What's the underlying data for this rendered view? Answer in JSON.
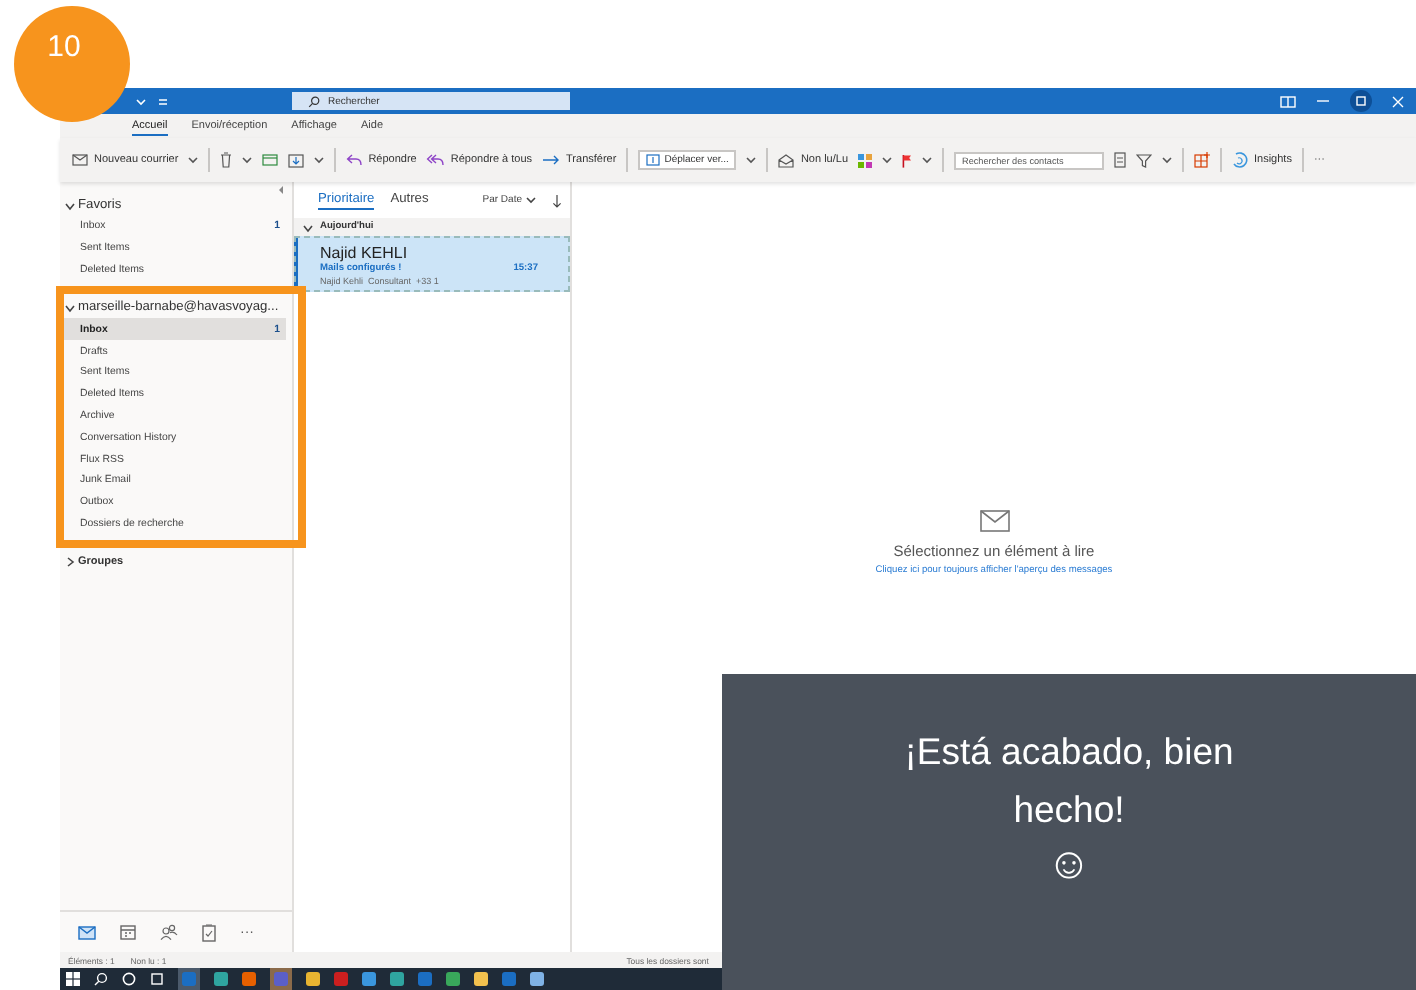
{
  "badge": "10",
  "title_bar": {
    "search_placeholder": "Rechercher"
  },
  "ribbon_tabs": [
    {
      "label": "Accueil",
      "selected": true
    },
    {
      "label": "Envoi/réception",
      "selected": false
    },
    {
      "label": "Affichage",
      "selected": false
    },
    {
      "label": "Aide",
      "selected": false
    }
  ],
  "toolbar": {
    "new_mail": "Nouveau courrier",
    "reply": "Répondre",
    "reply_all": "Répondre à tous",
    "forward": "Transférer",
    "move": "Déplacer ver...",
    "read_unread": "Non lu/Lu",
    "contact_search": {
      "placeholder": "Rechercher des contacts"
    },
    "insights": "Insights",
    "more": "···"
  },
  "folder_pane": {
    "sections": [
      {
        "label": "Favoris",
        "expanded": true,
        "items": [
          {
            "label": "Inbox",
            "count": "1",
            "selected": false
          },
          {
            "label": "Sent Items",
            "selected": false
          },
          {
            "label": "Deleted Items",
            "selected": false
          }
        ]
      },
      {
        "label": "marseille-barnabe@havasvoyag...",
        "expanded": true,
        "items": [
          {
            "label": "Inbox",
            "count": "1",
            "selected": true
          },
          {
            "label": "Drafts",
            "selected": false
          },
          {
            "label": "Sent Items",
            "selected": false
          },
          {
            "label": "Deleted Items",
            "selected": false
          },
          {
            "label": "Archive",
            "selected": false
          },
          {
            "label": "Conversation History",
            "selected": false
          },
          {
            "label": "Flux RSS",
            "selected": false
          },
          {
            "label": "Junk Email",
            "selected": false
          },
          {
            "label": "Outbox",
            "selected": false
          },
          {
            "label": "Dossiers de recherche",
            "selected": false
          }
        ]
      },
      {
        "label": "Groupes",
        "expanded": false
      }
    ],
    "nav": [
      {
        "selected": true
      },
      {
        "selected": false
      },
      {
        "selected": false
      },
      {
        "selected": false
      },
      {
        "label": "···",
        "selected": false
      }
    ]
  },
  "message_list": {
    "tabs": [
      {
        "label": "Prioritaire",
        "selected": true
      },
      {
        "label": "Autres",
        "selected": false
      }
    ],
    "sort": "Par Date",
    "groups": [
      {
        "label": "Aujourd'hui",
        "expanded": true,
        "messages": [
          {
            "sender": "Najid KEHLI",
            "subject": "Mails configurés !",
            "time": "15:37",
            "preview": "Najid Kehli  Consultant  +33 1",
            "selected": true
          }
        ]
      }
    ]
  },
  "reading_pane": {
    "message": "Sélectionnez un élément à lire",
    "link": "Cliquez ici pour toujours afficher l'aperçu des messages"
  },
  "status_bar": {
    "items": "Éléments : 1",
    "unread": "Non lu : 1",
    "sync": "Tous les dossiers sont"
  },
  "overlay": {
    "text": "¡Está acabado, bien hecho!",
    "emoji": "☺"
  }
}
